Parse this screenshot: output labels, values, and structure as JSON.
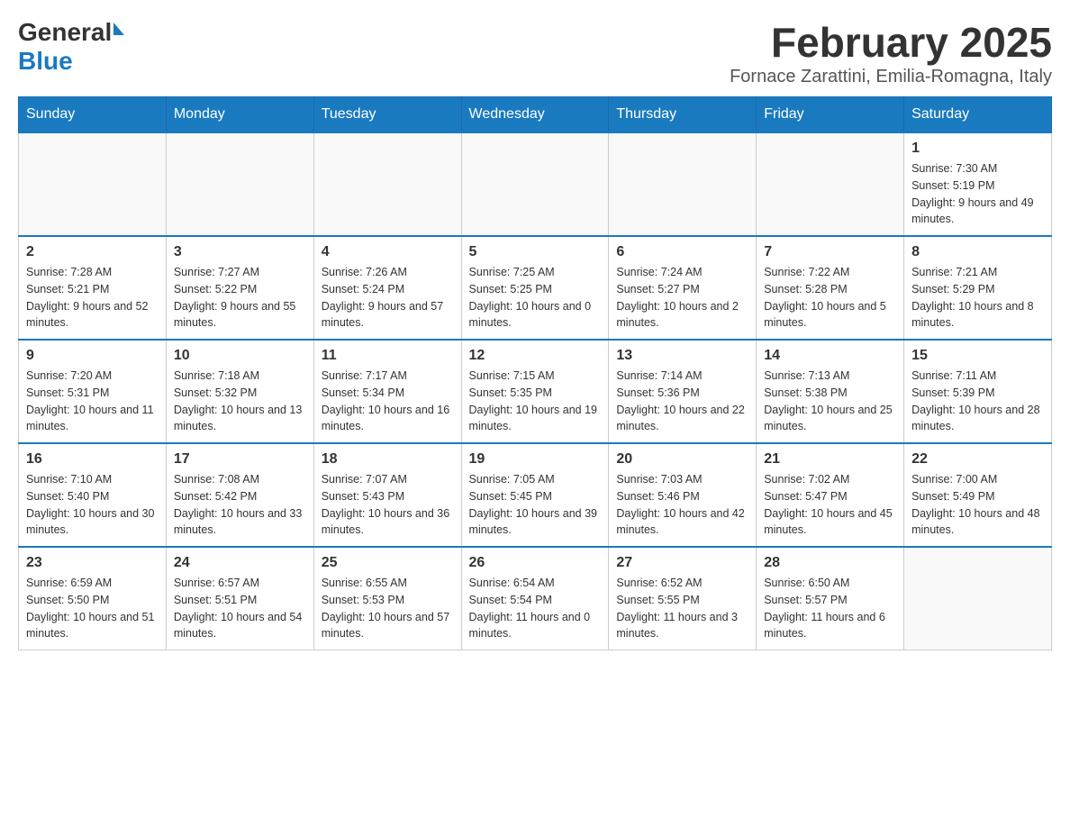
{
  "header": {
    "logo_general": "General",
    "logo_blue": "Blue",
    "month_title": "February 2025",
    "subtitle": "Fornace Zarattini, Emilia-Romagna, Italy"
  },
  "weekdays": [
    "Sunday",
    "Monday",
    "Tuesday",
    "Wednesday",
    "Thursday",
    "Friday",
    "Saturday"
  ],
  "weeks": [
    [
      {
        "day": "",
        "info": ""
      },
      {
        "day": "",
        "info": ""
      },
      {
        "day": "",
        "info": ""
      },
      {
        "day": "",
        "info": ""
      },
      {
        "day": "",
        "info": ""
      },
      {
        "day": "",
        "info": ""
      },
      {
        "day": "1",
        "info": "Sunrise: 7:30 AM\nSunset: 5:19 PM\nDaylight: 9 hours and 49 minutes."
      }
    ],
    [
      {
        "day": "2",
        "info": "Sunrise: 7:28 AM\nSunset: 5:21 PM\nDaylight: 9 hours and 52 minutes."
      },
      {
        "day": "3",
        "info": "Sunrise: 7:27 AM\nSunset: 5:22 PM\nDaylight: 9 hours and 55 minutes."
      },
      {
        "day": "4",
        "info": "Sunrise: 7:26 AM\nSunset: 5:24 PM\nDaylight: 9 hours and 57 minutes."
      },
      {
        "day": "5",
        "info": "Sunrise: 7:25 AM\nSunset: 5:25 PM\nDaylight: 10 hours and 0 minutes."
      },
      {
        "day": "6",
        "info": "Sunrise: 7:24 AM\nSunset: 5:27 PM\nDaylight: 10 hours and 2 minutes."
      },
      {
        "day": "7",
        "info": "Sunrise: 7:22 AM\nSunset: 5:28 PM\nDaylight: 10 hours and 5 minutes."
      },
      {
        "day": "8",
        "info": "Sunrise: 7:21 AM\nSunset: 5:29 PM\nDaylight: 10 hours and 8 minutes."
      }
    ],
    [
      {
        "day": "9",
        "info": "Sunrise: 7:20 AM\nSunset: 5:31 PM\nDaylight: 10 hours and 11 minutes."
      },
      {
        "day": "10",
        "info": "Sunrise: 7:18 AM\nSunset: 5:32 PM\nDaylight: 10 hours and 13 minutes."
      },
      {
        "day": "11",
        "info": "Sunrise: 7:17 AM\nSunset: 5:34 PM\nDaylight: 10 hours and 16 minutes."
      },
      {
        "day": "12",
        "info": "Sunrise: 7:15 AM\nSunset: 5:35 PM\nDaylight: 10 hours and 19 minutes."
      },
      {
        "day": "13",
        "info": "Sunrise: 7:14 AM\nSunset: 5:36 PM\nDaylight: 10 hours and 22 minutes."
      },
      {
        "day": "14",
        "info": "Sunrise: 7:13 AM\nSunset: 5:38 PM\nDaylight: 10 hours and 25 minutes."
      },
      {
        "day": "15",
        "info": "Sunrise: 7:11 AM\nSunset: 5:39 PM\nDaylight: 10 hours and 28 minutes."
      }
    ],
    [
      {
        "day": "16",
        "info": "Sunrise: 7:10 AM\nSunset: 5:40 PM\nDaylight: 10 hours and 30 minutes."
      },
      {
        "day": "17",
        "info": "Sunrise: 7:08 AM\nSunset: 5:42 PM\nDaylight: 10 hours and 33 minutes."
      },
      {
        "day": "18",
        "info": "Sunrise: 7:07 AM\nSunset: 5:43 PM\nDaylight: 10 hours and 36 minutes."
      },
      {
        "day": "19",
        "info": "Sunrise: 7:05 AM\nSunset: 5:45 PM\nDaylight: 10 hours and 39 minutes."
      },
      {
        "day": "20",
        "info": "Sunrise: 7:03 AM\nSunset: 5:46 PM\nDaylight: 10 hours and 42 minutes."
      },
      {
        "day": "21",
        "info": "Sunrise: 7:02 AM\nSunset: 5:47 PM\nDaylight: 10 hours and 45 minutes."
      },
      {
        "day": "22",
        "info": "Sunrise: 7:00 AM\nSunset: 5:49 PM\nDaylight: 10 hours and 48 minutes."
      }
    ],
    [
      {
        "day": "23",
        "info": "Sunrise: 6:59 AM\nSunset: 5:50 PM\nDaylight: 10 hours and 51 minutes."
      },
      {
        "day": "24",
        "info": "Sunrise: 6:57 AM\nSunset: 5:51 PM\nDaylight: 10 hours and 54 minutes."
      },
      {
        "day": "25",
        "info": "Sunrise: 6:55 AM\nSunset: 5:53 PM\nDaylight: 10 hours and 57 minutes."
      },
      {
        "day": "26",
        "info": "Sunrise: 6:54 AM\nSunset: 5:54 PM\nDaylight: 11 hours and 0 minutes."
      },
      {
        "day": "27",
        "info": "Sunrise: 6:52 AM\nSunset: 5:55 PM\nDaylight: 11 hours and 3 minutes."
      },
      {
        "day": "28",
        "info": "Sunrise: 6:50 AM\nSunset: 5:57 PM\nDaylight: 11 hours and 6 minutes."
      },
      {
        "day": "",
        "info": ""
      }
    ]
  ]
}
